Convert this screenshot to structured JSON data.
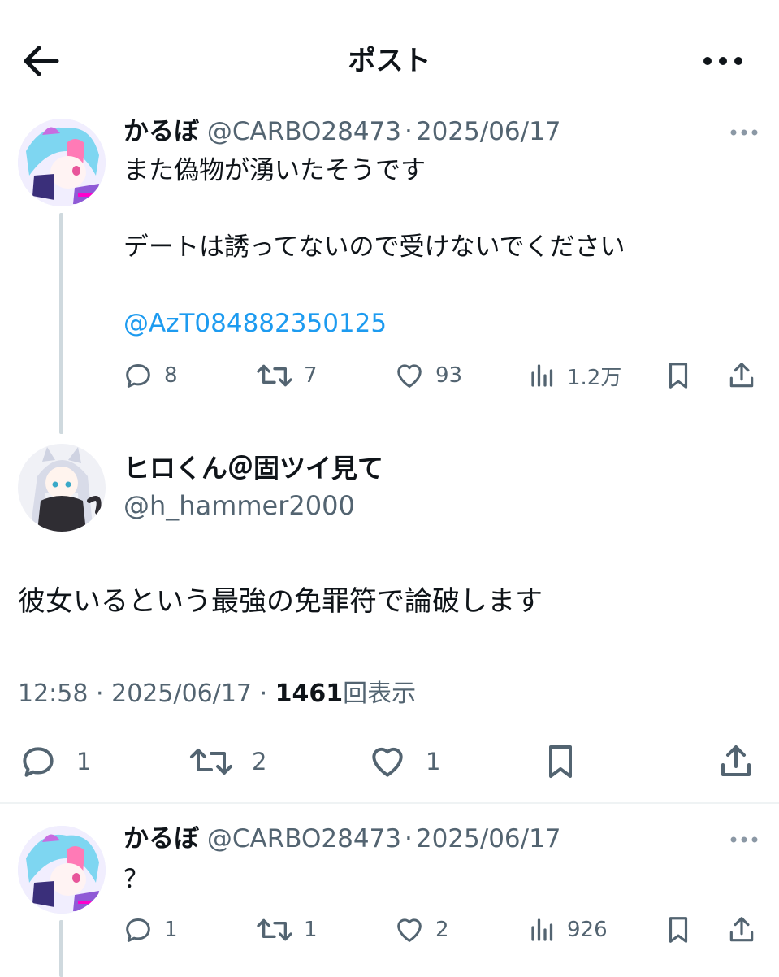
{
  "header": {
    "title": "ポスト"
  },
  "thread": {
    "parent": {
      "name": "かるぼ",
      "handle": "@CARBO28473",
      "separator": "·",
      "date": "2025/06/17",
      "line1": "また偽物が湧いたそうです",
      "line2": "デートは誘ってないので受けないでください",
      "mention": "@AzT084882350125",
      "replies": "8",
      "reposts": "7",
      "likes": "93",
      "views": "1.2万"
    },
    "focal": {
      "name": "ヒロくん＠固ツイ見て",
      "handle": "@h_hammer2000",
      "text": "彼女いるという最強の免罪符で論破します",
      "time": "12:58",
      "separator": "·",
      "date": "2025/06/17",
      "views_count": "1461",
      "views_label": "回表示",
      "replies": "1",
      "reposts": "2",
      "likes": "1"
    },
    "reply": {
      "name": "かるぼ",
      "handle": "@CARBO28473",
      "separator": "·",
      "date": "2025/06/17",
      "text": "？",
      "replies": "1",
      "reposts": "1",
      "likes": "2",
      "views": "926"
    }
  },
  "colors": {
    "text": "#0f1419",
    "secondary": "#536471",
    "link": "#1d9bf0",
    "thread_line": "#cfd9de"
  },
  "icons": [
    "back-arrow-icon",
    "more-icon",
    "reply-icon",
    "repost-icon",
    "like-icon",
    "views-icon",
    "bookmark-icon",
    "share-icon"
  ]
}
